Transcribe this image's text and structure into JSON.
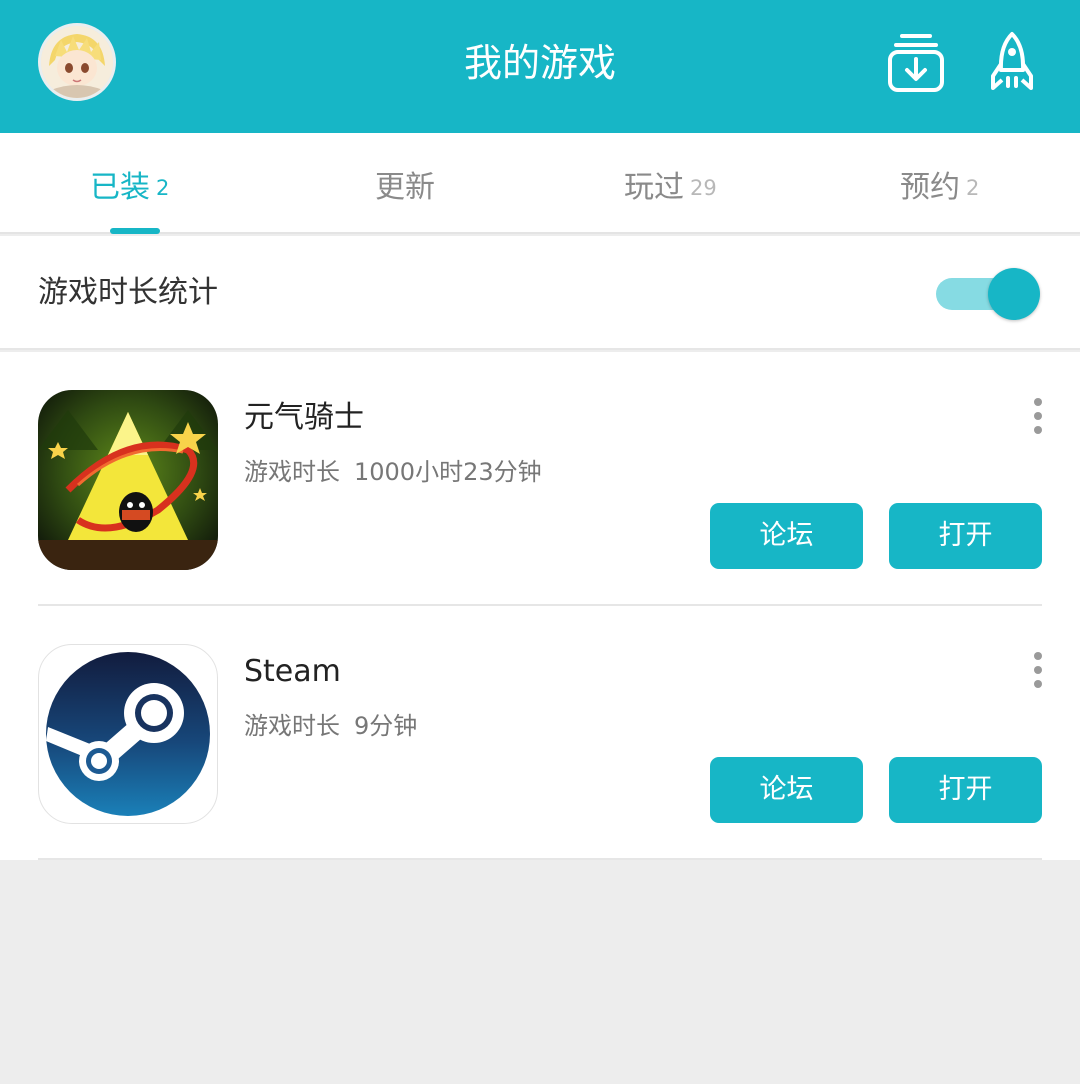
{
  "header": {
    "title": "我的游戏"
  },
  "tabs": [
    {
      "label": "已装",
      "count": "2",
      "active": true
    },
    {
      "label": "更新",
      "count": "",
      "active": false
    },
    {
      "label": "玩过",
      "count": "29",
      "active": false
    },
    {
      "label": "预约",
      "count": "2",
      "active": false
    }
  ],
  "stats": {
    "label": "游戏时长统计",
    "enabled": true
  },
  "games": [
    {
      "name": "元气骑士",
      "playtime_label": "游戏时长",
      "playtime_value": "1000小时23分钟",
      "forum_label": "论坛",
      "open_label": "打开"
    },
    {
      "name": "Steam",
      "playtime_label": "游戏时长",
      "playtime_value": "9分钟",
      "forum_label": "论坛",
      "open_label": "打开"
    }
  ],
  "colors": {
    "accent": "#17b6c6",
    "toggle_track": "#86dbe3",
    "background": "#ededed"
  },
  "icons": {
    "avatar": "anime-avatar",
    "download": "download-box-icon",
    "rocket": "rocket-icon",
    "more": "more-vertical-icon"
  }
}
